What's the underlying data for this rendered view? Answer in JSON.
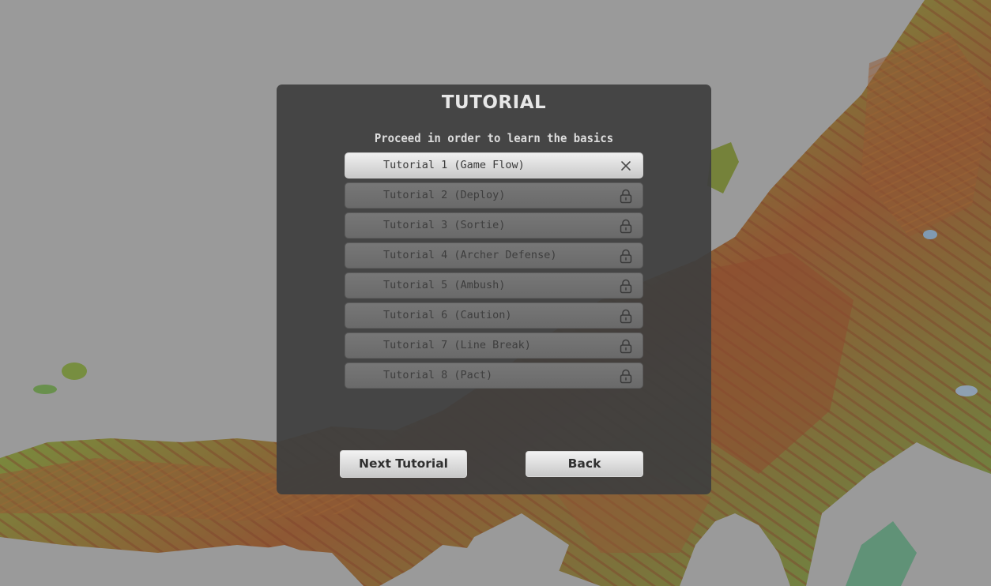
{
  "panel": {
    "title": "TUTORIAL",
    "subtitle": "Proceed in order to learn the basics"
  },
  "tutorials": [
    {
      "label": "Tutorial 1 (Game Flow)",
      "state": "selected",
      "icon": "close-icon"
    },
    {
      "label": "Tutorial 2 (Deploy)",
      "state": "locked",
      "icon": "lock-icon"
    },
    {
      "label": "Tutorial 3 (Sortie)",
      "state": "locked",
      "icon": "lock-icon"
    },
    {
      "label": "Tutorial 4 (Archer Defense)",
      "state": "locked",
      "icon": "lock-icon"
    },
    {
      "label": "Tutorial 5 (Ambush)",
      "state": "locked",
      "icon": "lock-icon"
    },
    {
      "label": "Tutorial 6 (Caution)",
      "state": "locked",
      "icon": "lock-icon"
    },
    {
      "label": "Tutorial 7 (Line Break)",
      "state": "locked",
      "icon": "lock-icon"
    },
    {
      "label": "Tutorial 8 (Pact)",
      "state": "locked",
      "icon": "lock-icon"
    }
  ],
  "buttons": {
    "next_label": "Next Tutorial",
    "back_label": "Back"
  },
  "colors": {
    "overlay": "#9a9a9a",
    "panel": "#3e3e3e",
    "map_low": "#2f8d8a",
    "map_mid": "#6d8f2a",
    "map_high": "#8a3d1b"
  }
}
